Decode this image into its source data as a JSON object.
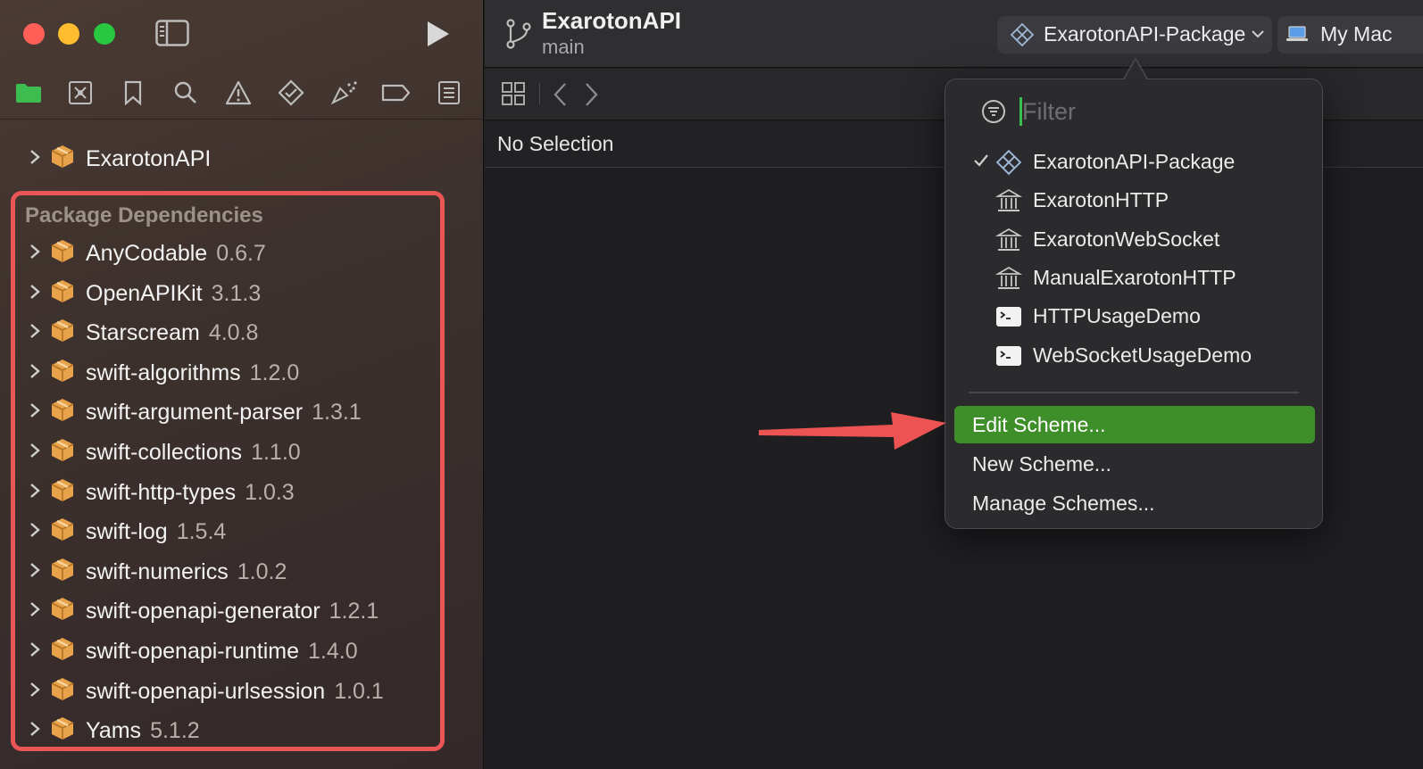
{
  "window": {
    "project_name": "ExarotonAPI",
    "branch": "main"
  },
  "toolbar": {
    "scheme": "ExarotonAPI-Package",
    "destination": "My Mac"
  },
  "navigator": {
    "tabs": [
      "folder-icon",
      "source-control-icon",
      "bookmark-icon",
      "search-icon",
      "warning-icon",
      "test-icon",
      "debug-icon",
      "breakpoint-icon",
      "report-icon"
    ],
    "root_item": "ExarotonAPI",
    "section_title": "Package Dependencies",
    "dependencies": [
      {
        "name": "AnyCodable",
        "version": "0.6.7"
      },
      {
        "name": "OpenAPIKit",
        "version": "3.1.3"
      },
      {
        "name": "Starscream",
        "version": "4.0.8"
      },
      {
        "name": "swift-algorithms",
        "version": "1.2.0"
      },
      {
        "name": "swift-argument-parser",
        "version": "1.3.1"
      },
      {
        "name": "swift-collections",
        "version": "1.1.0"
      },
      {
        "name": "swift-http-types",
        "version": "1.0.3"
      },
      {
        "name": "swift-log",
        "version": "1.5.4"
      },
      {
        "name": "swift-numerics",
        "version": "1.0.2"
      },
      {
        "name": "swift-openapi-generator",
        "version": "1.2.1"
      },
      {
        "name": "swift-openapi-runtime",
        "version": "1.4.0"
      },
      {
        "name": "swift-openapi-urlsession",
        "version": "1.0.1"
      },
      {
        "name": "Yams",
        "version": "5.1.2"
      }
    ]
  },
  "editor": {
    "jump_bar": "No Selection"
  },
  "scheme_menu": {
    "filter_placeholder": "Filter",
    "schemes": [
      {
        "label": "ExarotonAPI-Package",
        "icon": "package-scheme-icon",
        "checked": true
      },
      {
        "label": "ExarotonHTTP",
        "icon": "library-icon",
        "checked": false
      },
      {
        "label": "ExarotonWebSocket",
        "icon": "library-icon",
        "checked": false
      },
      {
        "label": "ManualExarotonHTTP",
        "icon": "library-icon",
        "checked": false
      },
      {
        "label": "HTTPUsageDemo",
        "icon": "terminal-icon",
        "checked": false
      },
      {
        "label": "WebSocketUsageDemo",
        "icon": "terminal-icon",
        "checked": false
      }
    ],
    "actions": [
      "Edit Scheme...",
      "New Scheme...",
      "Manage Schemes..."
    ],
    "highlighted_action": "Edit Scheme..."
  },
  "colors": {
    "highlight_box": "#ea5656",
    "menu_selection": "#3e8e2a",
    "arrow": "#ec5353",
    "package_icon": "#e8a34a"
  }
}
